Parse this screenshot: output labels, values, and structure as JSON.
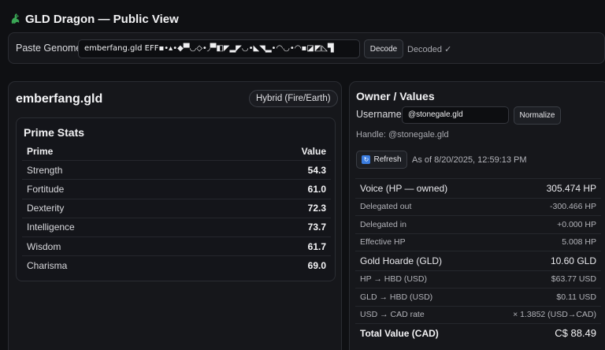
{
  "app": {
    "title": "GLD Dragon — Public View"
  },
  "genome": {
    "label": "Paste Genome",
    "value": "emberfang.gld EFF▪•▴•◆▀◡◇•◞▀◧◤▂◤◡•◣◥▂•◠◡•◠▪◪◩◺▜",
    "decode_label": "Decode",
    "status": "Decoded ✓"
  },
  "dragon": {
    "name": "emberfang.gld",
    "type_badge": "Hybrid (Fire/Earth)"
  },
  "stats": {
    "title": "Prime Stats",
    "col_prime": "Prime",
    "col_value": "Value",
    "rows": [
      {
        "name": "Strength",
        "value": "54.3"
      },
      {
        "name": "Fortitude",
        "value": "61.0"
      },
      {
        "name": "Dexterity",
        "value": "72.3"
      },
      {
        "name": "Intelligence",
        "value": "73.7"
      },
      {
        "name": "Wisdom",
        "value": "61.7"
      },
      {
        "name": "Charisma",
        "value": "69.0"
      }
    ]
  },
  "owner": {
    "title": "Owner / Values",
    "username_label": "Username",
    "username_value": "@stonegale.gld",
    "normalize_label": "Normalize",
    "handle_text": "Handle: @stonegale.gld",
    "refresh_label": "Refresh",
    "as_of": "As of 8/20/2025, 12:59:13 PM",
    "values": [
      {
        "label": "Voice (HP — owned)",
        "value": "305.474 HP"
      },
      {
        "label": "Delegated out",
        "value": "-300.466 HP"
      },
      {
        "label": "Delegated in",
        "value": "+0.000 HP"
      },
      {
        "label": "Effective HP",
        "value": "5.008 HP"
      },
      {
        "label": "Gold Hoarde (GLD)",
        "value": "10.60 GLD"
      },
      {
        "label": "HP → HBD (USD)",
        "value": "$63.77 USD"
      },
      {
        "label": "GLD → HBD (USD)",
        "value": "$0.11 USD"
      },
      {
        "label": "USD → CAD rate",
        "value": "× 1.3852 (USD→CAD)"
      },
      {
        "label": "Total Value (CAD)",
        "value": "C$ 88.49"
      }
    ]
  },
  "icons": {
    "title_icon": "dragon-icon",
    "refresh_icon": "refresh-icon"
  },
  "colors": {
    "background": "#0f1013",
    "card": "#16171b",
    "border": "#2a2c32",
    "accent_blue": "#3b7de0",
    "dragon_green": "#3aa655"
  }
}
